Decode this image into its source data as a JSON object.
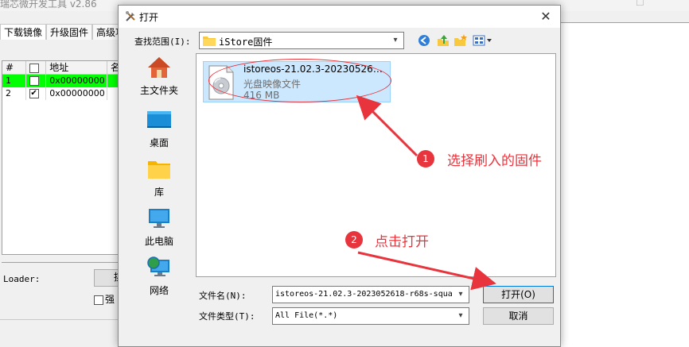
{
  "background_app": {
    "title": "瑞芯微开发工具 v2.86",
    "tabs": [
      "下载镜像",
      "升级固件",
      "高级功"
    ],
    "grid": {
      "headers": [
        "#",
        "",
        "地址",
        "名"
      ],
      "rows": [
        {
          "num": "1",
          "address": "0x00000000",
          "checked": false
        },
        {
          "num": "2",
          "address": "0x00000000",
          "checked": true
        }
      ]
    },
    "loader_label": "Loader:",
    "loader_button": "挑",
    "force_label": "强",
    "check_mark": "✔"
  },
  "dialog": {
    "title": "打开",
    "close_glyph": "✕",
    "look_in_label": "查找范围(I):",
    "look_in_value": "iStore固件",
    "dropdown_glyph": "▾",
    "places": [
      "主文件夹",
      "桌面",
      "库",
      "此电脑",
      "网络"
    ],
    "file": {
      "name": "istoreos-21.02.3-2023052618...",
      "type": "光盘映像文件",
      "size": "416 MB"
    },
    "filename_label": "文件名(N):",
    "filename_value": "istoreos-21.02.3-2023052618-r68s-squa",
    "filetype_label": "文件类型(T):",
    "filetype_value": "All File(*.*)",
    "open_button": "打开(O)",
    "cancel_button": "取消"
  },
  "annotations": {
    "step1_badge": "1",
    "step1_text": "选择刷入的固件",
    "step2_badge": "2",
    "step2_text": "点击打开",
    "color": "#e8343c"
  },
  "colors": {
    "selection_fill": "#cce8ff",
    "grid_highlight": "#00ff00",
    "accent": "#0078d7"
  }
}
